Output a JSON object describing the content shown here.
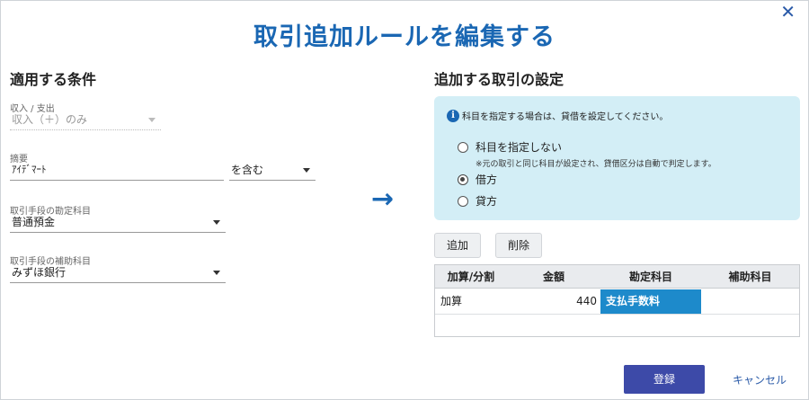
{
  "dialog": {
    "title": "取引追加ルールを編集する",
    "close_glyph": "✕"
  },
  "conditions": {
    "heading": "適用する条件",
    "income_expense": {
      "label": "収入 / 支出",
      "value": "収入（＋）のみ"
    },
    "description": {
      "label": "摘要",
      "value": "ｱｲﾃﾞﾏｰﾄ",
      "match_mode": "を含む"
    },
    "account": {
      "label": "取引手段の勘定科目",
      "value": "普通預金"
    },
    "sub_account": {
      "label": "取引手段の補助科目",
      "value": "みずほ銀行"
    }
  },
  "arrow_glyph": "→",
  "settings": {
    "heading": "追加する取引の設定",
    "info": {
      "icon": "i",
      "text": "科目を指定する場合は、貸借を設定してください。"
    },
    "options": [
      {
        "label": "科目を指定しない",
        "checked": false
      },
      {
        "label": "借方",
        "checked": true
      },
      {
        "label": "貸方",
        "checked": false
      }
    ],
    "option_note": "※元の取引と同じ科目が設定され、貸借区分は自動で判定します。",
    "add_label": "追加",
    "delete_label": "削除",
    "table": {
      "headers": [
        "加算/分割",
        "金額",
        "勘定科目",
        "補助科目"
      ],
      "rows": [
        {
          "type": "加算",
          "amount": "440",
          "account": "支払手数料",
          "sub_account": ""
        }
      ]
    }
  },
  "footer": {
    "submit_label": "登録",
    "cancel_label": "キャンセル"
  },
  "colors": {
    "title": "#1a67b3",
    "info_bg": "#d3eef6",
    "primary_button": "#3d4aa8",
    "selected_cell": "#1d8acb"
  }
}
